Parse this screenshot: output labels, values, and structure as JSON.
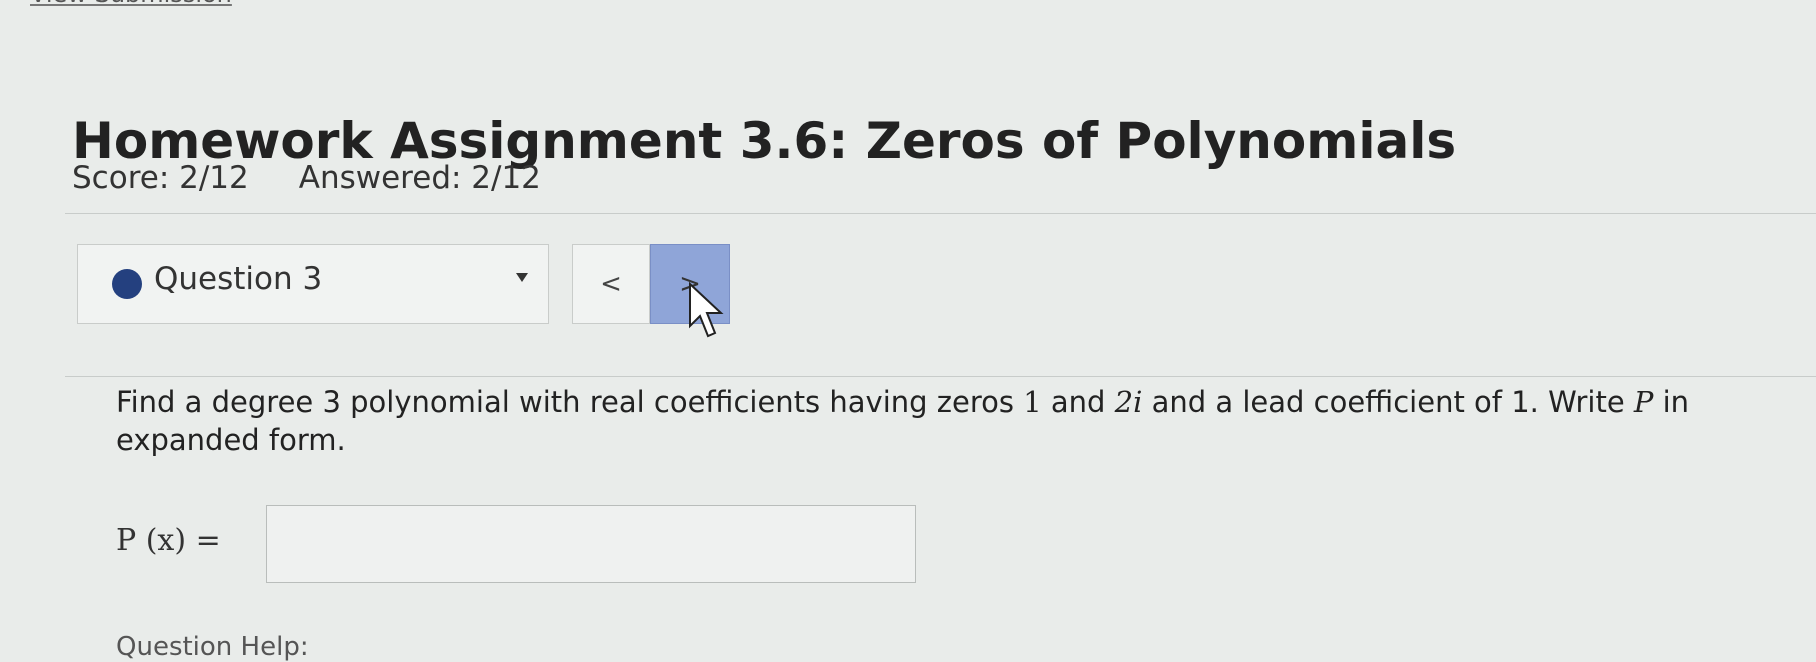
{
  "header": {
    "link_text": "View Submission",
    "title": "Homework Assignment 3.6: Zeros of Polynomials",
    "score": "Score: 2/12",
    "answered": "Answered: 2/12"
  },
  "question_nav": {
    "selected": "Question 3",
    "prev": "<",
    "next": ">"
  },
  "question": {
    "text_part1": "Find a degree 3 polynomial with real coefficients having zeros ",
    "zero1": "1",
    "text_part2": " and ",
    "zero2": "2i",
    "text_part3": " and a lead coefficient of 1. Write ",
    "var_p": "P",
    "text_part4": " in expanded form.",
    "answer_label": "P (x) =",
    "answer_value": ""
  },
  "footer": {
    "help": "Question Help:"
  },
  "colors": {
    "accent_dot": "#24407f",
    "next_button": "#8fa5d8"
  }
}
